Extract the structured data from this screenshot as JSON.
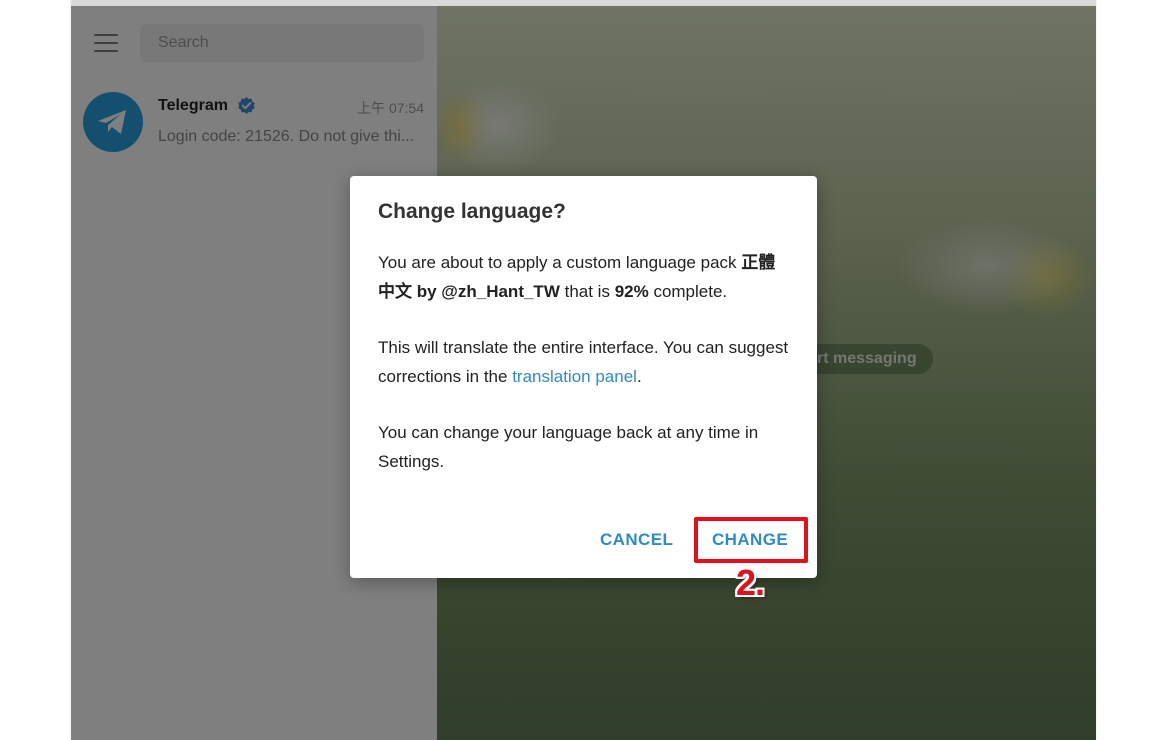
{
  "sidebar": {
    "search_placeholder": "Search",
    "chats": [
      {
        "name": "Telegram",
        "verified": true,
        "time": "上午 07:54",
        "preview": "Login code: 21526. Do not give thi..."
      }
    ]
  },
  "chat_area": {
    "service_message": "rt messaging"
  },
  "dialog": {
    "title": "Change language?",
    "para1": {
      "text1": "You are about to apply a custom language pack ",
      "pack_name": "正體中文 by @zh_Hant_TW",
      "text2": " that is ",
      "percent": "92%",
      "text3": " complete."
    },
    "para2": {
      "text1": "This will translate the entire interface. You can suggest corrections in the ",
      "link": "translation panel",
      "text2": "."
    },
    "para3": "You can change your language back at any time in Settings.",
    "cancel_label": "CANCEL",
    "change_label": "CHANGE"
  },
  "annotation": {
    "step_label": "2.",
    "color": "#e2101a"
  },
  "colors": {
    "accent": "#2f8cc9",
    "avatar": "#2a9fe0"
  }
}
